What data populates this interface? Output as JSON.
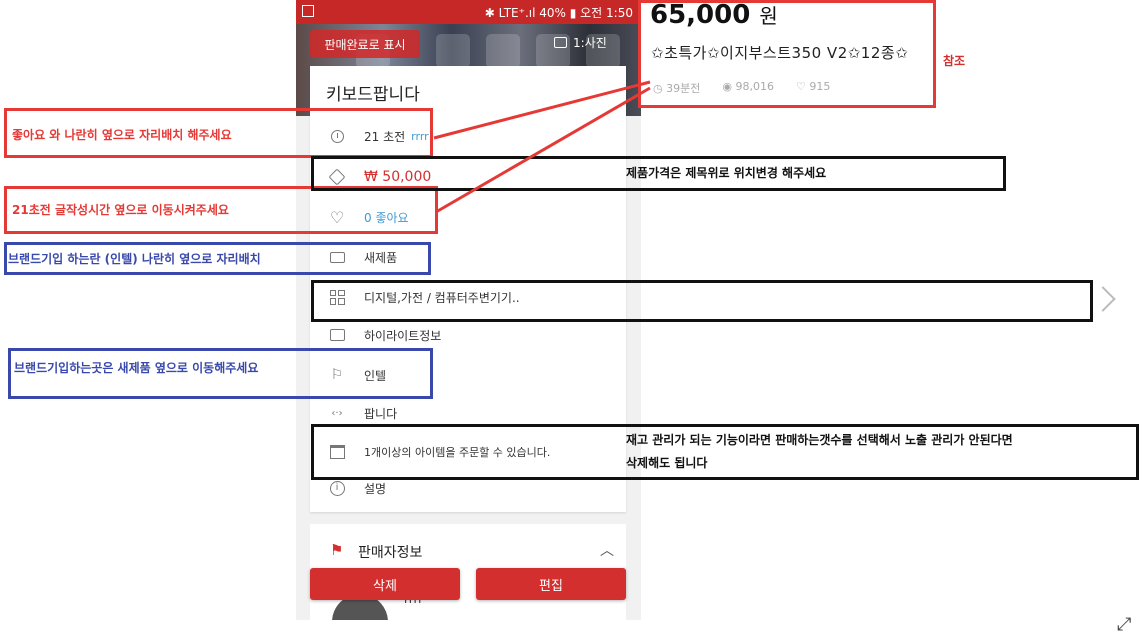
{
  "status_bar": {
    "text": "✱ LTE⁺.ıl 40% ▮ 오전 1:50"
  },
  "hero": {
    "sold_label": "판매완료로 표시",
    "photo_count": "1:사진"
  },
  "product": {
    "title": "키보드팝니다",
    "time": "21 초전",
    "time_user": "rrrr",
    "price": "₩ 50,000",
    "likes": "0 좋아요",
    "condition": "새제품",
    "category": "디지털,가전 / 컴퓨터주변기기..",
    "highlight": "하이라이트정보",
    "brand": "인텔",
    "trade": "팝니다",
    "multi_order": "1개이상의 아이템을 주문할 수 있습니다.",
    "description": "설명"
  },
  "seller": {
    "title": "판매자정보",
    "name": "rrrr"
  },
  "actions": {
    "delete": "삭제",
    "edit": "편집"
  },
  "reference": {
    "price": "65,000",
    "price_unit": "원",
    "name": "✩초특가✩이지부스트350 V2✩12종✩",
    "time": "39분전",
    "views": "98,016",
    "likes": "915",
    "label": "참조"
  },
  "annotations": {
    "likes_beside": "좋아요 와 나란히 옆으로 자리배치 해주세요",
    "move_time": "21초전 글작성시간 옆으로 이동시켜주세요",
    "brand_beside": "브랜드기입 하는란 (인텔) 나란히 옆으로 자리배치",
    "brand_move": "브랜드기입하는곳은 새제품 옆으로 이동해주세요",
    "price_above": "제품가격은 제목위로 위치변경 해주세요",
    "inventory_line1": "재고 관리가 되는 기능이라면 판매하는갯수를 선택해서 노출 관리가 안된다면",
    "inventory_line2": "삭제해도 됩니다"
  },
  "colors": {
    "brand_red": "#d32f2f",
    "annotation_red": "#e53935",
    "annotation_blue": "#3949ab",
    "link_blue": "#3e9bd5"
  }
}
